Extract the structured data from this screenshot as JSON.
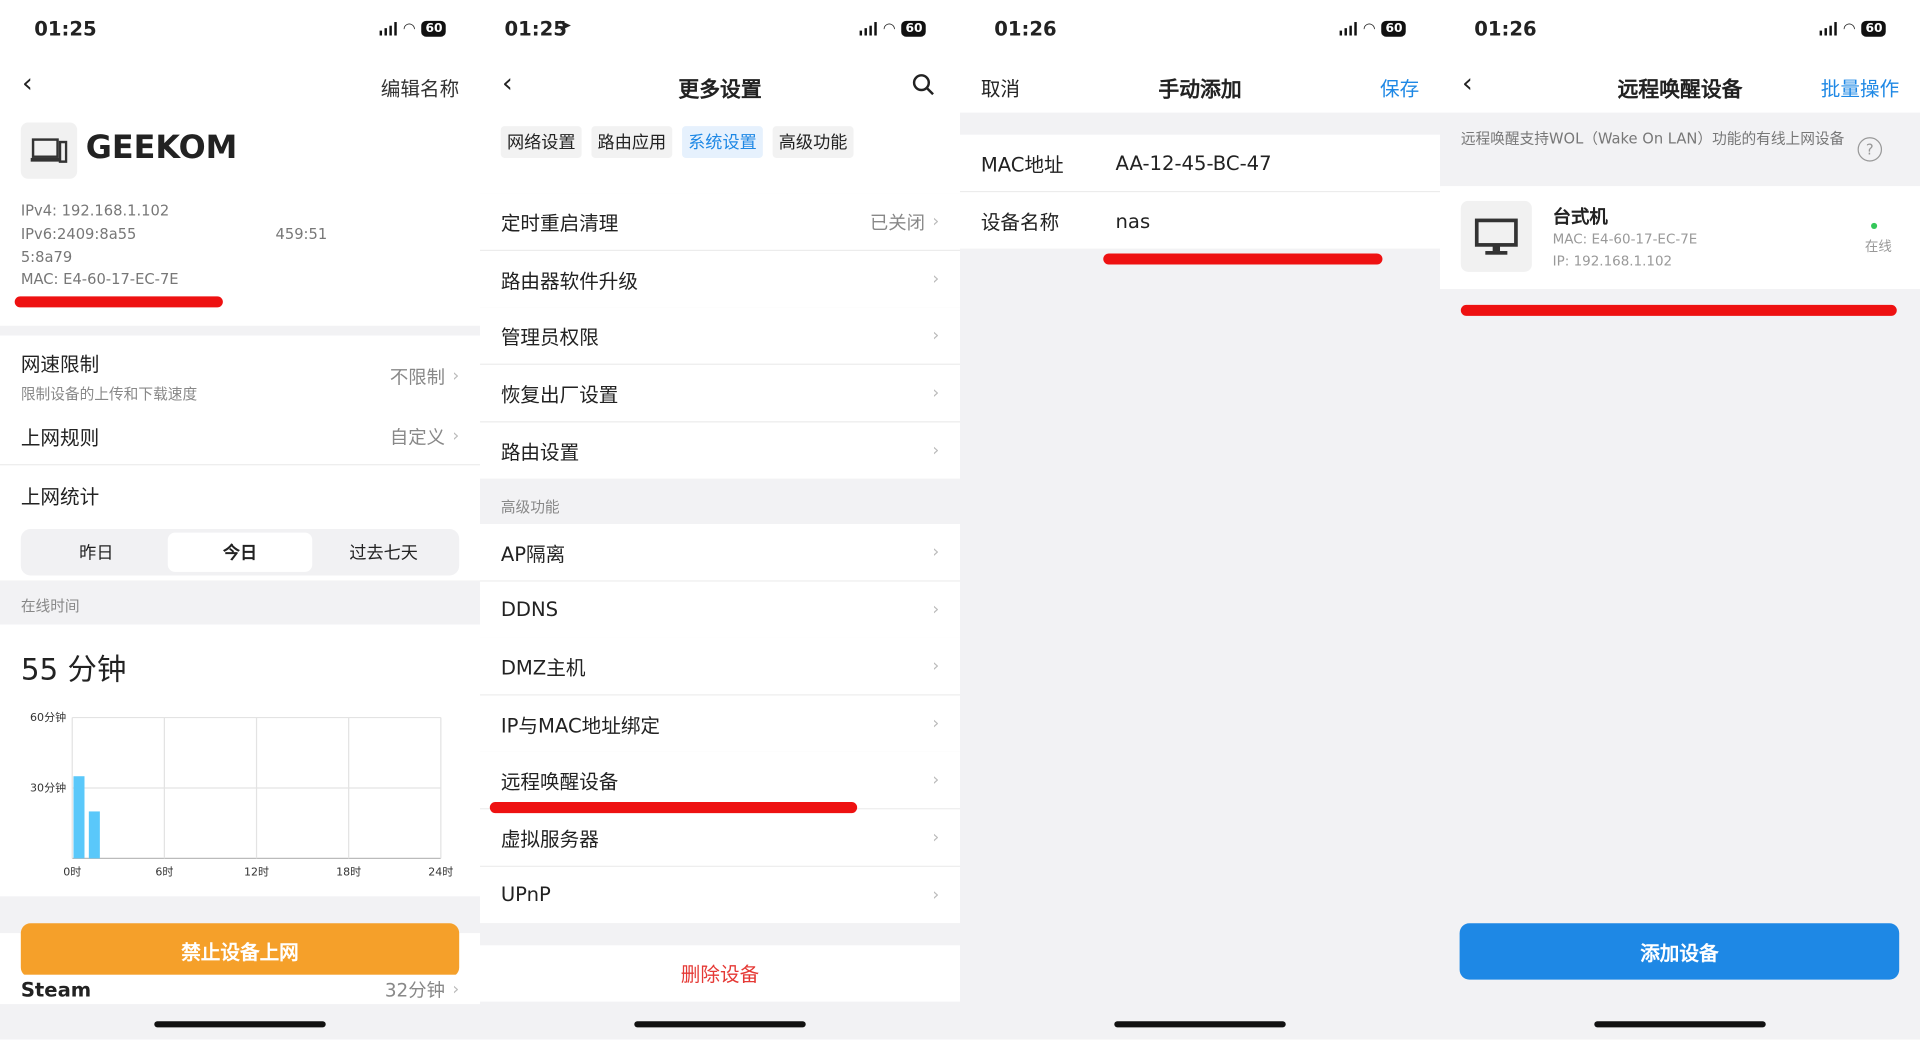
{
  "panel1": {
    "status_time": "01:25",
    "battery": "60",
    "edit_name": "编辑名称",
    "device_name": "GEEKOM",
    "ipv4": "IPv4: 192.168.1.102",
    "ipv6_line1": "IPv6:2409:8a55",
    "ipv6_mid": "459:51",
    "ipv6_line2": "5:8a79",
    "mac": "MAC: E4-60-17-EC-7E",
    "speed_limit": {
      "label": "网速限制",
      "sub": "限制设备的上传和下载速度",
      "value": "不限制"
    },
    "rules": {
      "label": "上网规则",
      "value": "自定义"
    },
    "stats_label": "上网统计",
    "segments": [
      "昨日",
      "今日",
      "过去七天"
    ],
    "online_time_label": "在线时间",
    "online_time": "55 分钟",
    "bottom_button": "禁止设备上网",
    "app_row": {
      "label": "Steam",
      "value": "32分钟"
    }
  },
  "chart_data": {
    "type": "bar",
    "x": [
      0,
      1
    ],
    "values": [
      35,
      20
    ],
    "xlabel": "",
    "ylabel": "",
    "xticks": [
      "0时",
      "6时",
      "12时",
      "18时",
      "24时"
    ],
    "yticks": [
      "60分钟",
      "30分钟"
    ],
    "ylim": [
      0,
      60
    ],
    "xlim": [
      0,
      24
    ],
    "grid": true,
    "bar_color": "#5ac8fa"
  },
  "panel2": {
    "status_time": "01:25",
    "battery": "60",
    "title": "更多设置",
    "tabs": [
      "网络设置",
      "路由应用",
      "系统设置",
      "高级功能"
    ],
    "active_tab": 2,
    "rows_top": [
      {
        "label": "定时重启清理",
        "value": "已关闭"
      },
      {
        "label": "路由器软件升级",
        "value": ""
      },
      {
        "label": "管理员权限",
        "value": ""
      },
      {
        "label": "恢复出厂设置",
        "value": ""
      },
      {
        "label": "路由设置",
        "value": ""
      }
    ],
    "section": "高级功能",
    "rows_adv": [
      {
        "label": "AP隔离"
      },
      {
        "label": "DDNS"
      },
      {
        "label": "DMZ主机"
      },
      {
        "label": "IP与MAC地址绑定"
      },
      {
        "label": "远程唤醒设备"
      },
      {
        "label": "虚拟服务器"
      },
      {
        "label": "UPnP"
      }
    ],
    "delete": "删除设备"
  },
  "panel3": {
    "status_time": "01:26",
    "battery": "60",
    "cancel": "取消",
    "title": "手动添加",
    "save": "保存",
    "mac_label": "MAC地址",
    "mac_value": "AA-12-45-BC-47",
    "name_label": "设备名称",
    "name_value": "nas"
  },
  "panel4": {
    "status_time": "01:26",
    "battery": "60",
    "title": "远程唤醒设备",
    "batch": "批量操作",
    "info": "远程唤醒支持WOL（Wake On LAN）功能的有线上网设备",
    "device": {
      "name": "台式机",
      "mac": "MAC: E4-60-17-EC-7E",
      "ip": "IP: 192.168.1.102",
      "status": "在线"
    },
    "add_button": "添加设备"
  },
  "colors": {
    "accent": "#1e88e5",
    "orange": "#f5a02a",
    "red": "#e53935",
    "bar": "#5ac8fa",
    "online": "#34c759"
  }
}
